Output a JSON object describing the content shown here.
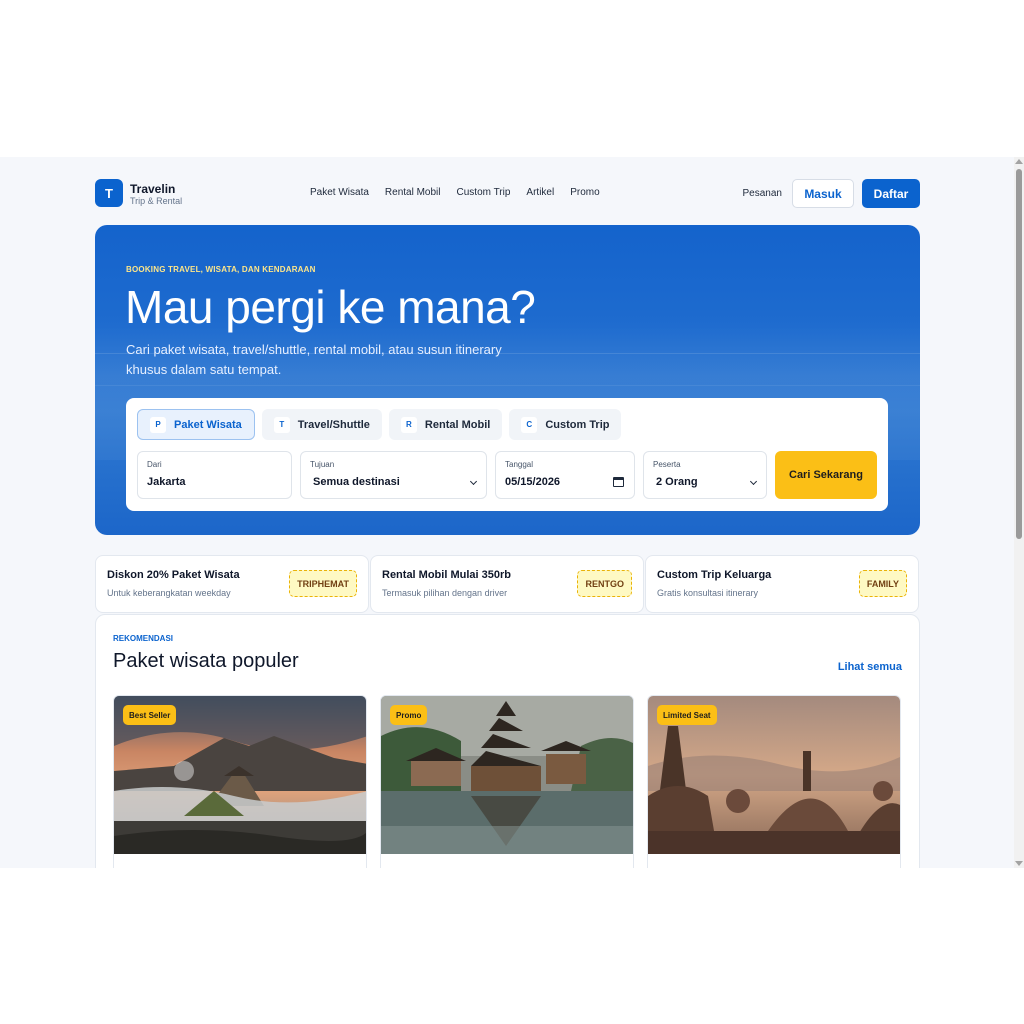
{
  "brand": {
    "logo_letter": "T",
    "name": "Travelin",
    "tagline": "Trip & Rental"
  },
  "nav": [
    "Paket Wisata",
    "Rental Mobil",
    "Custom Trip",
    "Artikel",
    "Promo"
  ],
  "header_actions": {
    "orders": "Pesanan",
    "login": "Masuk",
    "register": "Daftar"
  },
  "hero": {
    "eyebrow": "BOOKING TRAVEL, WISATA, DAN KENDARAAN",
    "title": "Mau pergi ke mana?",
    "subtitle": "Cari paket wisata, travel/shuttle, rental mobil, atau susun itinerary khusus dalam satu tempat."
  },
  "search": {
    "tabs": [
      {
        "icon": "P",
        "label": "Paket Wisata",
        "active": true
      },
      {
        "icon": "T",
        "label": "Travel/Shuttle",
        "active": false
      },
      {
        "icon": "R",
        "label": "Rental Mobil",
        "active": false
      },
      {
        "icon": "C",
        "label": "Custom Trip",
        "active": false
      }
    ],
    "from": {
      "label": "Dari",
      "value": "Jakarta"
    },
    "destination": {
      "label": "Tujuan",
      "value": "Semua destinasi"
    },
    "date": {
      "label": "Tanggal",
      "value": "05/15/2026"
    },
    "participants": {
      "label": "Peserta",
      "value": "2 Orang"
    },
    "submit": "Cari Sekarang"
  },
  "promos": [
    {
      "title": "Diskon 20% Paket Wisata",
      "subtitle": "Untuk keberangkatan weekday",
      "code": "TRIPHEMAT"
    },
    {
      "title": "Rental Mobil Mulai 350rb",
      "subtitle": "Termasuk pilihan dengan driver",
      "code": "RENTGO"
    },
    {
      "title": "Custom Trip Keluarga",
      "subtitle": "Gratis konsultasi itinerary",
      "code": "FAMILY"
    }
  ],
  "recommendations": {
    "eyebrow": "REKOMENDASI",
    "title": "Paket wisata populer",
    "see_all": "Lihat semua",
    "cards": [
      {
        "badge": "Best Seller",
        "image": "mountain-volcano-photo"
      },
      {
        "badge": "Promo",
        "image": "lake-temple-photo"
      },
      {
        "badge": "Limited Seat",
        "image": "stupa-temple-photo"
      }
    ]
  },
  "colors": {
    "primary": "#0b63ce",
    "accent": "#fbbf16",
    "background": "#f5f7fb"
  }
}
